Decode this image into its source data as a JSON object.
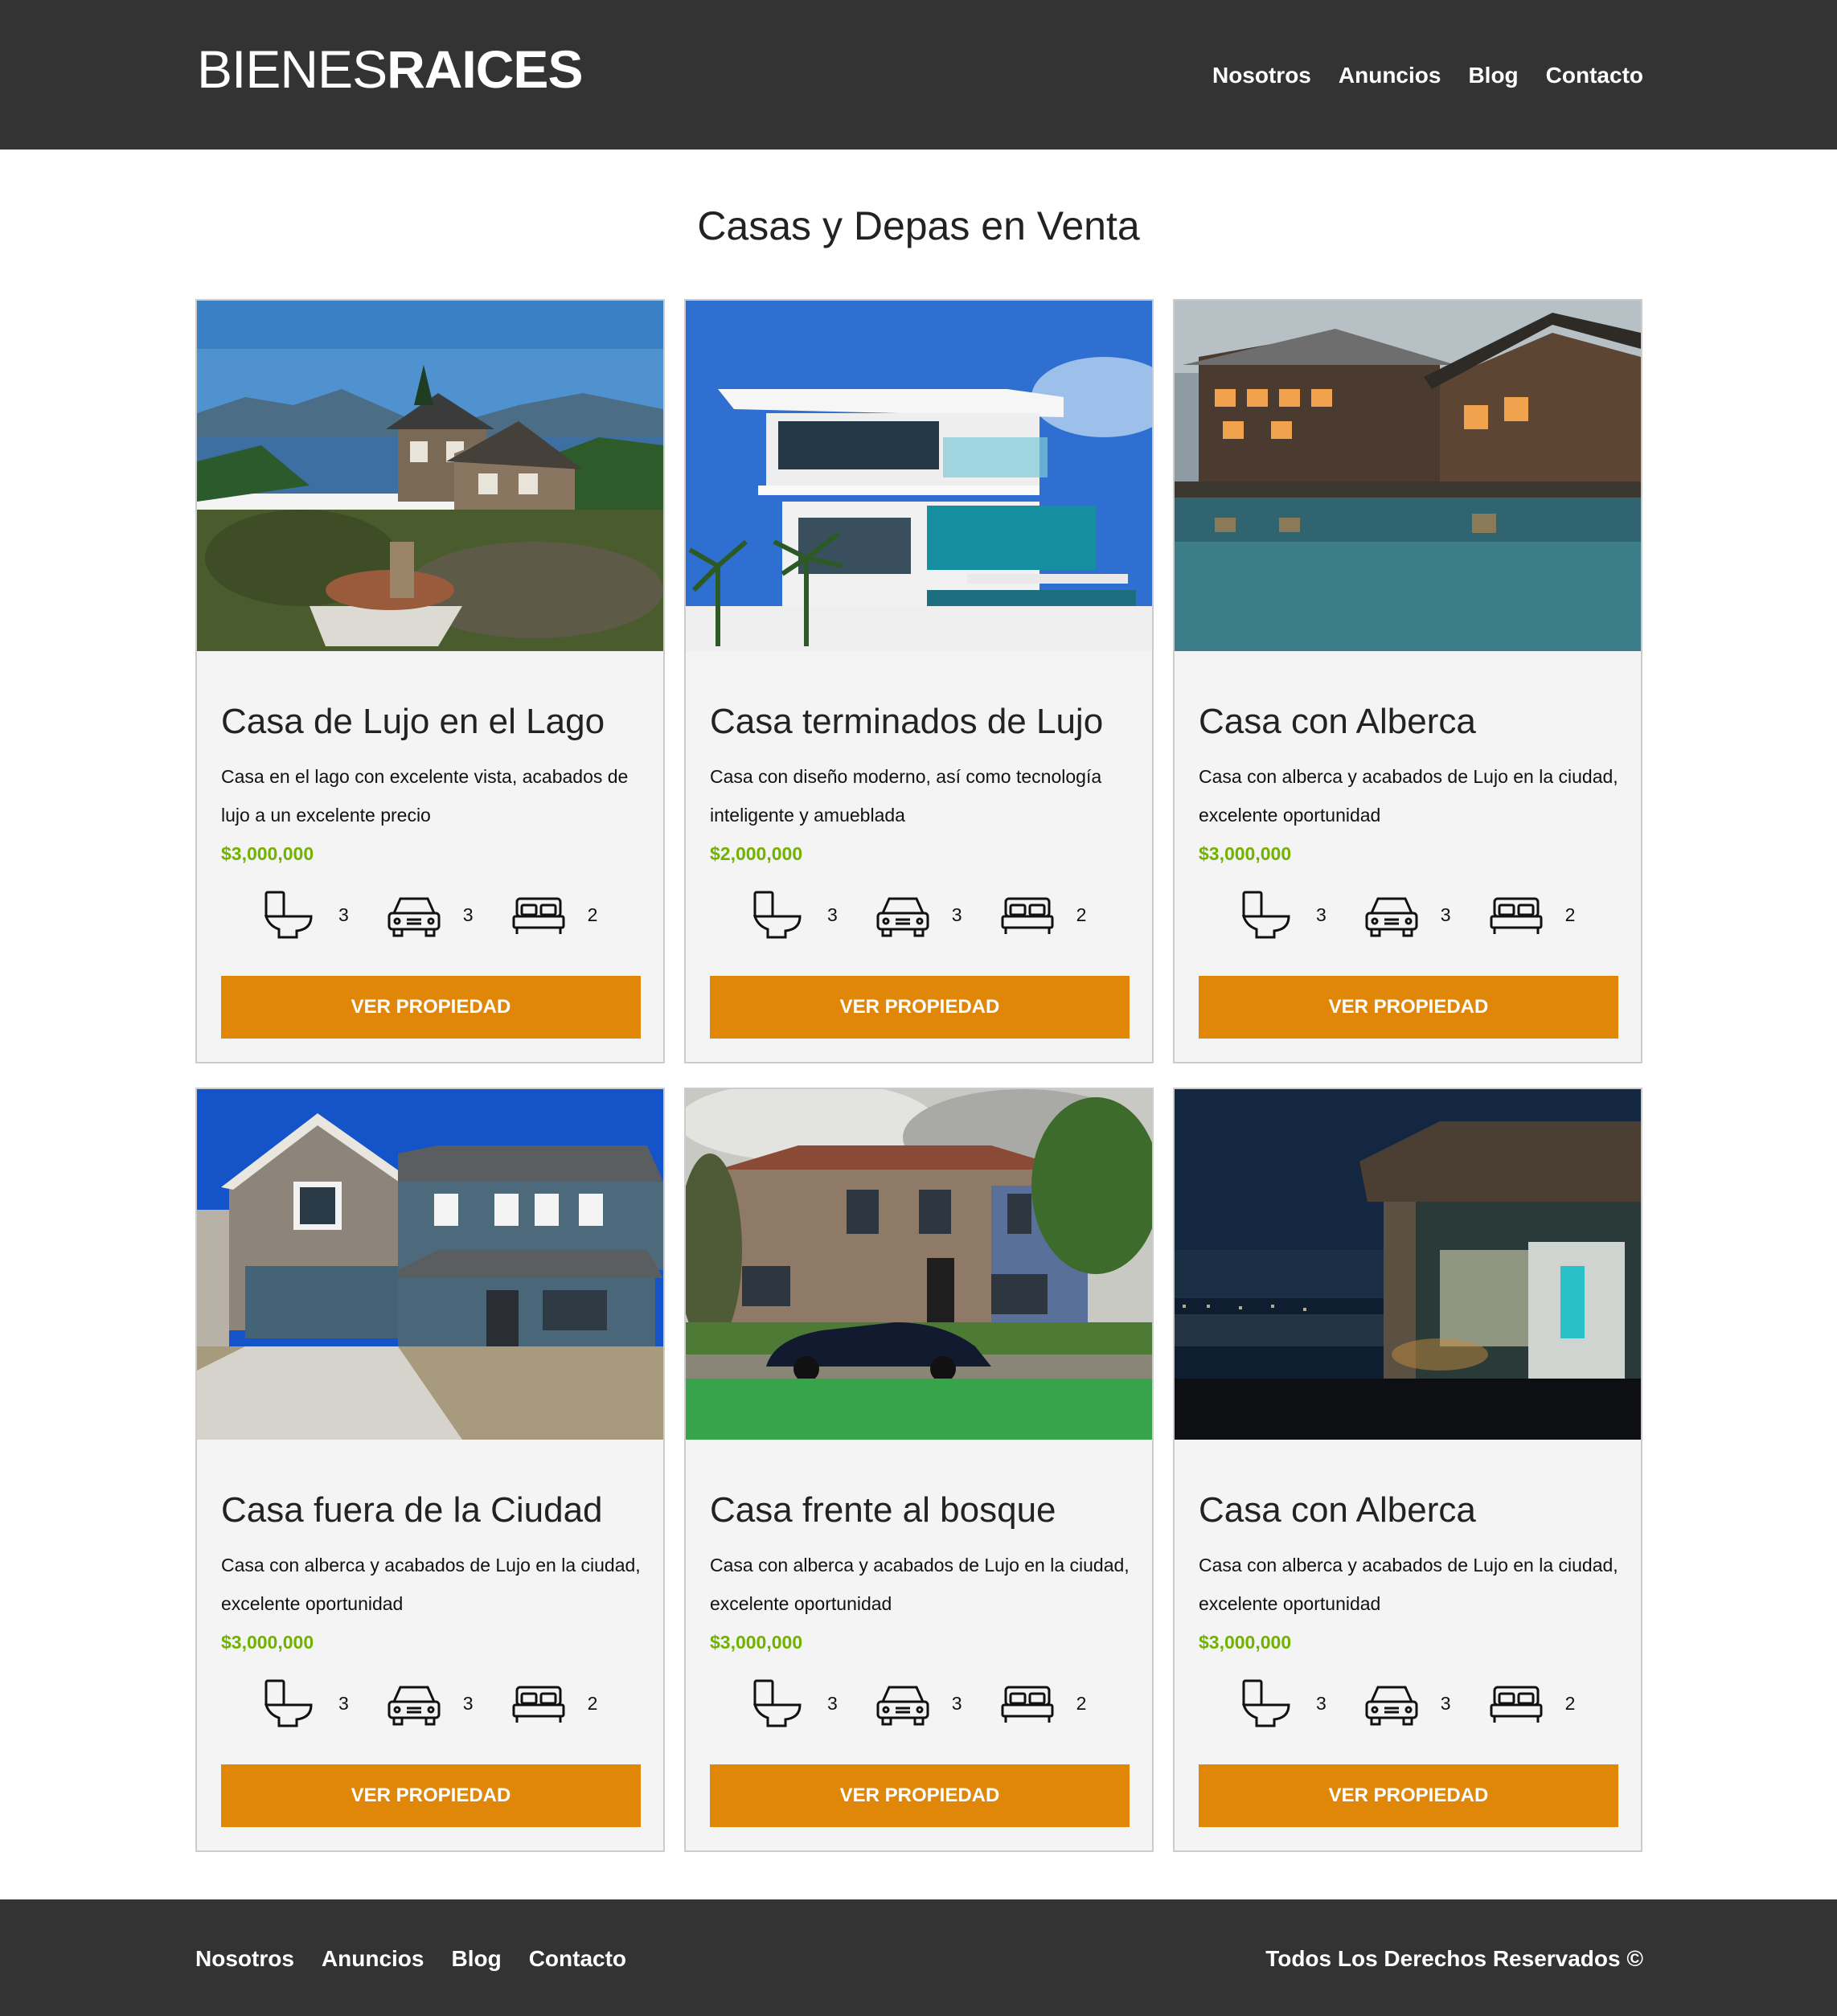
{
  "header": {
    "logo_thin": "BIENES",
    "logo_bold": "RAICES",
    "nav": [
      "Nosotros",
      "Anuncios",
      "Blog",
      "Contacto"
    ]
  },
  "page_title": "Casas y Depas en Venta",
  "listings": [
    {
      "title": "Casa de Lujo en el Lago",
      "description": "Casa en el lago con excelente vista, acabados de lujo a un excelente precio",
      "price": "$3,000,000",
      "bathrooms": "3",
      "parking": "3",
      "bedrooms": "2",
      "button": "VER PROPIEDAD",
      "image": "lake-house"
    },
    {
      "title": "Casa terminados de Lujo",
      "description": "Casa con diseño moderno, así como tecnología inteligente y amueblada",
      "price": "$2,000,000",
      "bathrooms": "3",
      "parking": "3",
      "bedrooms": "2",
      "button": "VER PROPIEDAD",
      "image": "modern-house"
    },
    {
      "title": "Casa con Alberca",
      "description": "Casa con alberca y acabados de Lujo en la ciudad, excelente oportunidad",
      "price": "$3,000,000",
      "bathrooms": "3",
      "parking": "3",
      "bedrooms": "2",
      "button": "VER PROPIEDAD",
      "image": "pool-lodge"
    },
    {
      "title": "Casa fuera de la Ciudad",
      "description": "Casa con alberca y acabados de Lujo en la ciudad, excelente oportunidad",
      "price": "$3,000,000",
      "bathrooms": "3",
      "parking": "3",
      "bedrooms": "2",
      "button": "VER PROPIEDAD",
      "image": "suburban-house"
    },
    {
      "title": "Casa frente al bosque",
      "description": "Casa con alberca y acabados de Lujo en la ciudad, excelente oportunidad",
      "price": "$3,000,000",
      "bathrooms": "3",
      "parking": "3",
      "bedrooms": "2",
      "button": "VER PROPIEDAD",
      "image": "brick-house"
    },
    {
      "title": "Casa con Alberca",
      "description": "Casa con alberca y acabados de Lujo en la ciudad, excelente oportunidad",
      "price": "$3,000,000",
      "bathrooms": "3",
      "parking": "3",
      "bedrooms": "2",
      "button": "VER PROPIEDAD",
      "image": "night-house"
    }
  ],
  "footer": {
    "nav": [
      "Nosotros",
      "Anuncios",
      "Blog",
      "Contacto"
    ],
    "copyright": "Todos Los Derechos Reservados ©"
  },
  "colors": {
    "header_bg": "#333333",
    "button": "#e08709",
    "price": "#71b100",
    "card_bg": "#f4f4f4"
  }
}
